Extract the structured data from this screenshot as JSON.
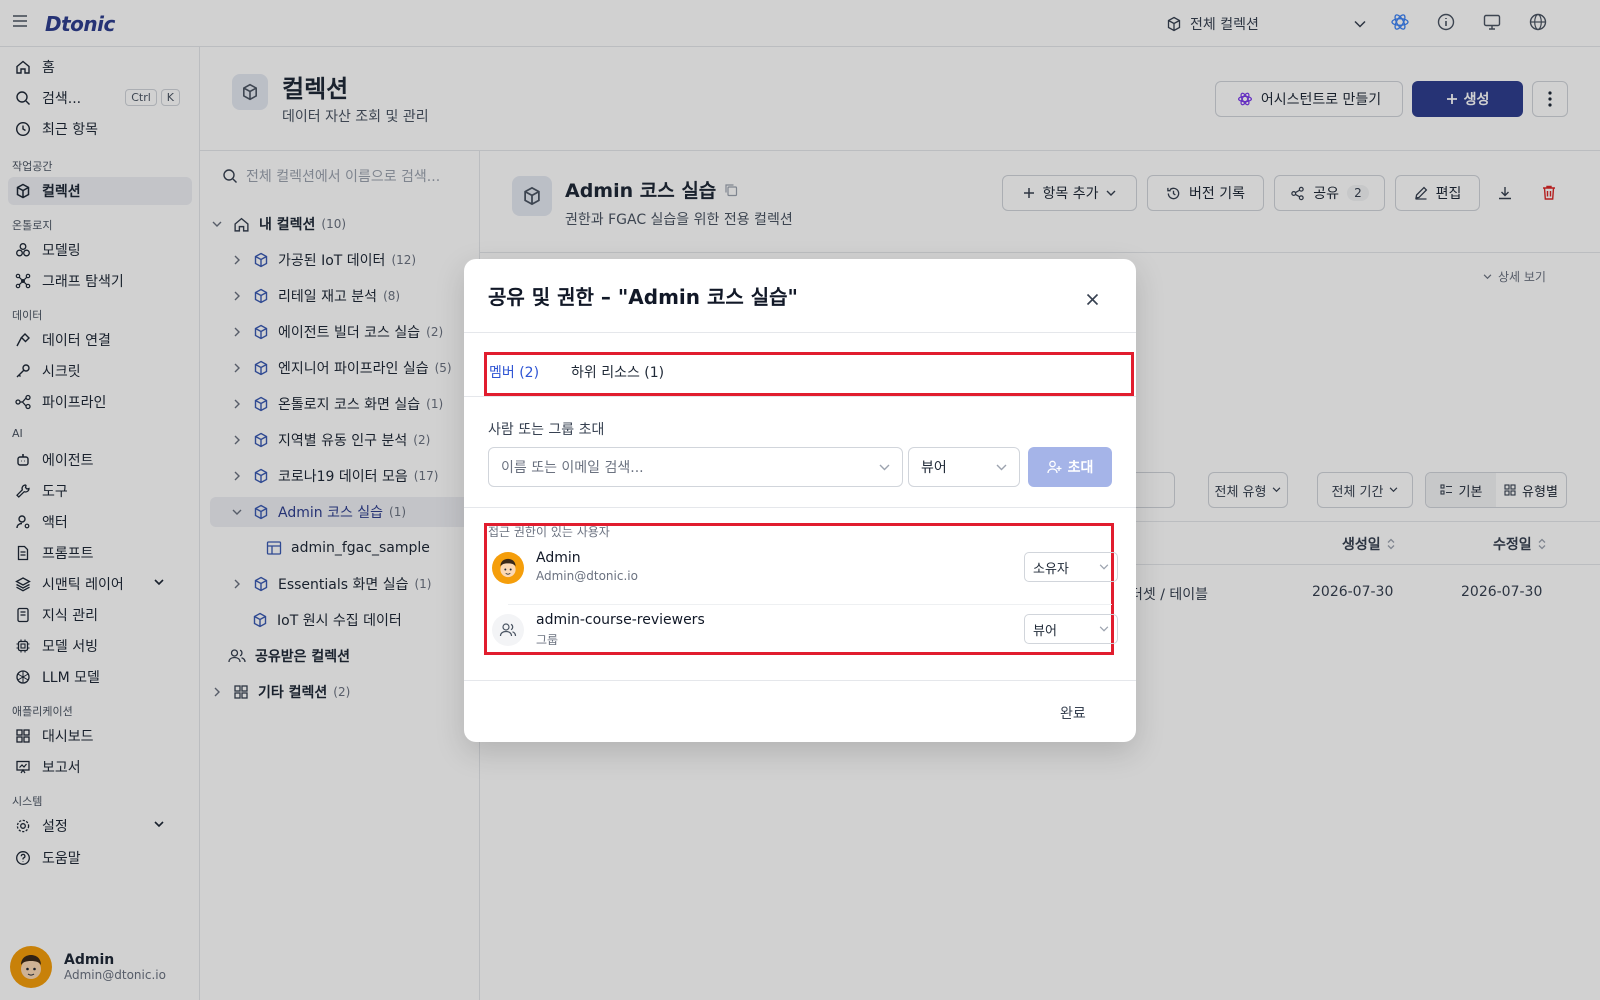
{
  "app": {
    "brand": "Dtonic"
  },
  "topbar": {
    "collection_scope": "전체 컬렉션"
  },
  "sidebar": {
    "home": "홈",
    "search": "검색...",
    "search_kbd1": "Ctrl",
    "search_kbd2": "K",
    "recent": "최근 항목",
    "sec_workspace": "작업공간",
    "collections": "컬렉션",
    "sec_ontology": "온톨로지",
    "modeling": "모델링",
    "graph": "그래프 탐색기",
    "sec_data": "데이터",
    "data_conn": "데이터 연결",
    "secrets": "시크릿",
    "pipeline": "파이프라인",
    "sec_ai": "AI",
    "agent": "에이전트",
    "tools": "도구",
    "actor": "액터",
    "prompt": "프롬프트",
    "semantic": "시맨틱 레이어",
    "knowledge": "지식 관리",
    "model_serving": "모델 서빙",
    "llm": "LLM 모델",
    "sec_apps": "애플리케이션",
    "dashboard": "대시보드",
    "report": "보고서",
    "sec_system": "시스템",
    "settings": "설정",
    "help": "도움말",
    "user_name": "Admin",
    "user_email": "Admin@dtonic.io"
  },
  "page": {
    "title": "컬렉션",
    "subtitle": "데이터 자산 조회 및 관리",
    "assist_btn": "어시스턴트로 만들기",
    "create_btn": "생성"
  },
  "tree": {
    "search_placeholder": "전체 컬렉션에서 이름으로 검색...",
    "my_collections": "내 컬렉션",
    "my_count": "(10)",
    "items": [
      {
        "label": "가공된 IoT 데이터",
        "count": "(12)"
      },
      {
        "label": "리테일 재고 분석",
        "count": "(8)"
      },
      {
        "label": "에이전트 빌더 코스 실습",
        "count": "(2)"
      },
      {
        "label": "엔지니어 파이프라인 실습",
        "count": "(5)"
      },
      {
        "label": "온톨로지 코스 화면 실습",
        "count": "(1)"
      },
      {
        "label": "지역별 유동 인구 분석",
        "count": "(2)"
      },
      {
        "label": "코로나19 데이터 모음",
        "count": "(17)"
      },
      {
        "label": "Admin 코스 실습",
        "count": "(1)"
      },
      {
        "label": "admin_fgac_sample",
        "count": ""
      },
      {
        "label": "Essentials 화면 실습",
        "count": "(1)"
      },
      {
        "label": "IoT 원시 수집 데이터",
        "count": ""
      }
    ],
    "shared": "공유받은 컬렉션",
    "other": "기타 컬렉션",
    "other_count": "(2)"
  },
  "detail": {
    "title": "Admin 코스 실습",
    "subtitle": "권한과 FGAC 실습을 위한 전용 컬렉션",
    "add_item": "항목 추가",
    "history": "버전 기록",
    "share": "공유",
    "share_count": "2",
    "edit": "편집",
    "detail_view": "상세 보기",
    "filter_type": "전체 유형",
    "filter_period": "전체 기간",
    "view_basic": "기본",
    "view_type": "유형별",
    "col_created": "생성일",
    "col_modified": "수정일",
    "row_type": "터셋 / 테이블",
    "row_created": "2026-07-30",
    "row_modified": "2026-07-30"
  },
  "modal": {
    "title": "공유 및 권한 – \"Admin 코스 실습\"",
    "tab_members": "멤버 (2)",
    "tab_subresources": "하위 리소스 (1)",
    "invite_label": "사람 또는 그룹 초대",
    "search_placeholder": "이름 또는 이메일 검색...",
    "invite_role": "뷰어",
    "invite_btn": "초대",
    "access_label": "접근 권한이 있는 사용자",
    "members": [
      {
        "name": "Admin",
        "sub": "Admin@dtonic.io",
        "role": "소유자"
      },
      {
        "name": "admin-course-reviewers",
        "sub": "그룹",
        "role": "뷰어"
      }
    ],
    "done": "완료"
  },
  "colors": {
    "brand": "#2f3f8f",
    "accent_tab": "#2f55d4",
    "highlight": "#e11d2e",
    "invite_disabled": "#a5b4e8"
  }
}
